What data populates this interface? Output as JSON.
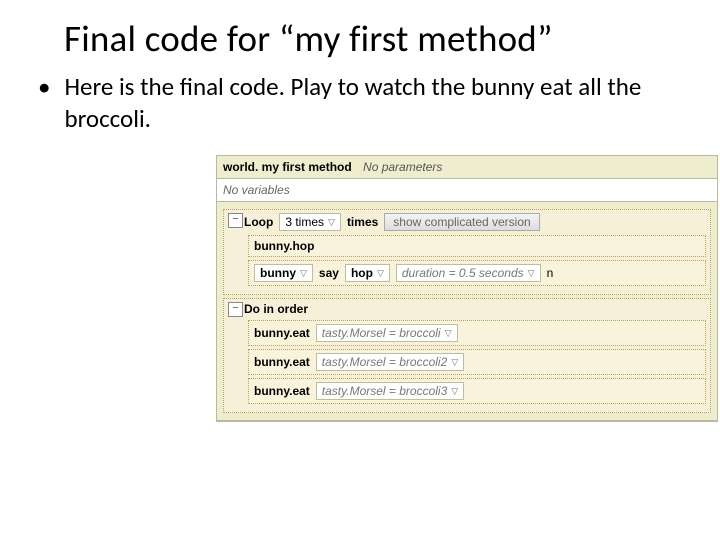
{
  "title": "Final code for “my first method”",
  "bullet": "Here is the final code. Play to watch the bunny eat all the broccoli.",
  "editor": {
    "method_path": "world. my first method",
    "params_note": "No parameters",
    "vars_note": "No variables",
    "loop": {
      "keyword": "Loop",
      "count": "3 times",
      "unit": "times",
      "button": "show complicated version",
      "rows": [
        {
          "call": "bunny.hop"
        },
        {
          "obj": "bunny",
          "verb": "say",
          "arg": "hop",
          "dur": "duration = 0.5 seconds",
          "tail": "n"
        }
      ]
    },
    "seq": {
      "keyword": "Do in order",
      "rows": [
        {
          "call": "bunny.eat",
          "param": "tasty.Morsel = broccoli"
        },
        {
          "call": "bunny.eat",
          "param": "tasty.Morsel = broccoli2"
        },
        {
          "call": "bunny.eat",
          "param": "tasty.Morsel = broccoli3"
        }
      ]
    }
  }
}
